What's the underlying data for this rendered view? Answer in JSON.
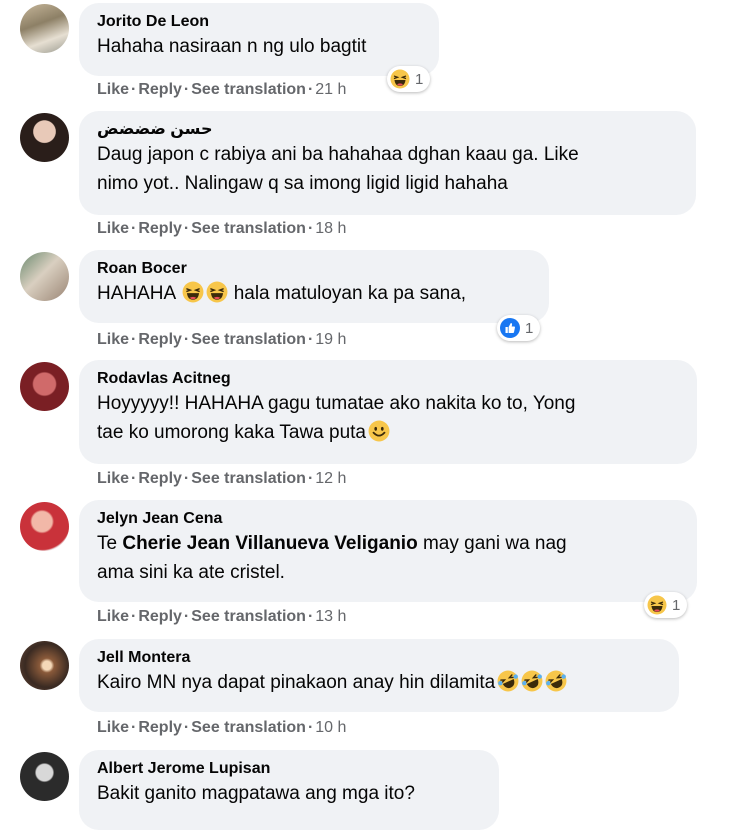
{
  "comments": [
    {
      "name": "Jorito De Leon",
      "text": "Hahaha nasiraan n ng ulo bagtit",
      "like": "Like",
      "reply": "Reply",
      "translate": "See translation",
      "time": "21 h",
      "reaction_count": "1"
    },
    {
      "name": "حسن ضضضض",
      "line1": "Daug japon c rabiya ani ba hahahaa dghan kaau ga. Like",
      "line2": "nimo yot.. Nalingaw q sa imong ligid ligid hahaha",
      "like": "Like",
      "reply": "Reply",
      "translate": "See translation",
      "time": "18 h"
    },
    {
      "name": "Roan Bocer",
      "text_a": "HAHAHA",
      "text_b": "hala matuloyan ka pa sana,",
      "like": "Like",
      "reply": "Reply",
      "translate": "See translation",
      "time": "19 h",
      "reaction_count": "1"
    },
    {
      "name": "Rodavlas Acitneg",
      "line1": "Hoyyyyy!! HAHAHA gagu tumatae ako nakita ko to, Yong",
      "line2": "tae ko umorong kaka Tawa puta",
      "like": "Like",
      "reply": "Reply",
      "translate": "See translation",
      "time": "12 h"
    },
    {
      "name": "Jelyn Jean Cena",
      "prefix": "Te",
      "mention": "Cherie Jean Villanueva Veliganio",
      "line1_rest": "may gani wa nag",
      "line2": "ama sini ka ate cristel.",
      "like": "Like",
      "reply": "Reply",
      "translate": "See translation",
      "time": "13 h",
      "reaction_count": "1"
    },
    {
      "name": "Jell Montera",
      "text": "Kairo MN nya dapat pinakaon anay hin dilamita",
      "like": "Like",
      "reply": "Reply",
      "translate": "See translation",
      "time": "10 h"
    },
    {
      "name": "Albert Jerome Lupisan",
      "text": "Bakit ganito magpatawa ang mga ito?"
    }
  ],
  "colors": {
    "bubble": "#f0f2f5",
    "secondary_text": "#65676b",
    "like_blue": "#1877f2",
    "emoji_yellow": "#f7c64a"
  },
  "icons": [
    "haha-reaction-icon",
    "like-reaction-icon",
    "smile-emoji-icon",
    "rofl-emoji-icon"
  ]
}
